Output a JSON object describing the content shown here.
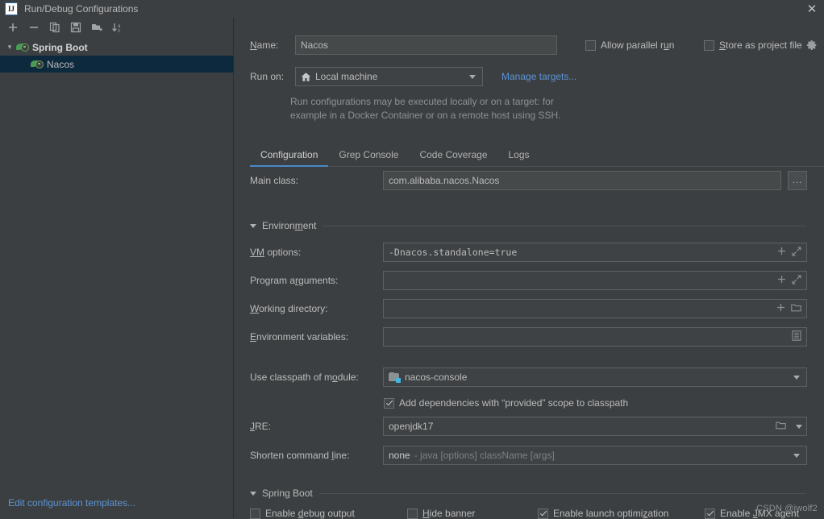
{
  "window": {
    "title": "Run/Debug Configurations",
    "app_icon": "IJ",
    "close_icon": "close-icon"
  },
  "sidebar": {
    "toolbar": [
      {
        "name": "add-configuration",
        "icon": "plus-icon"
      },
      {
        "name": "remove-configuration",
        "icon": "minus-icon"
      },
      {
        "name": "copy-configuration",
        "icon": "copy-icon"
      },
      {
        "name": "save-configuration",
        "icon": "save-icon"
      },
      {
        "name": "new-folder",
        "icon": "new-folder-icon"
      },
      {
        "name": "sort-configurations",
        "icon": "sort-alphabetical-icon"
      }
    ],
    "tree": {
      "group_label": "Spring Boot",
      "child_label": "Nacos"
    },
    "edit_templates_link": "Edit configuration templates..."
  },
  "form": {
    "name_label": "Name:",
    "name_value": "Nacos",
    "allow_parallel_run": {
      "label": "Allow parallel run",
      "checked": false
    },
    "store_as_project_file": {
      "label": "Store as project file",
      "checked": false
    },
    "run_on_label": "Run on:",
    "run_on_value": "Local machine",
    "manage_targets_link": "Manage targets...",
    "hint_line1": "Run configurations may be executed locally or on a target: for",
    "hint_line2": "example in a Docker Container or on a remote host using SSH.",
    "tabs": [
      {
        "label": "Configuration",
        "active": true
      },
      {
        "label": "Grep Console",
        "active": false
      },
      {
        "label": "Code Coverage",
        "active": false
      },
      {
        "label": "Logs",
        "active": false
      }
    ],
    "main_class": {
      "label": "Main class:",
      "value": "com.alibaba.nacos.Nacos",
      "browse_button": "..."
    },
    "environment_section": "Environment",
    "vm_options": {
      "label": "VM options:",
      "value": "-Dnacos.standalone=true"
    },
    "program_arguments": {
      "label": "Program arguments:",
      "value": ""
    },
    "working_directory": {
      "label": "Working directory:",
      "value": ""
    },
    "environment_variables": {
      "label": "Environment variables:",
      "value": ""
    },
    "use_classpath_of_module": {
      "label": "Use classpath of module:",
      "value": "nacos-console"
    },
    "add_provided_dependencies": {
      "label": "Add dependencies with “provided” scope to classpath",
      "checked": true
    },
    "jre": {
      "label": "JRE:",
      "value": "openjdk17"
    },
    "shorten_command_line": {
      "label": "Shorten command line:",
      "value": "none",
      "value_hint": "- java [options] className [args]"
    },
    "spring_boot_section": "Spring Boot",
    "spring_boot_options": [
      {
        "label": "Enable debug output",
        "checked": false
      },
      {
        "label": "Hide banner",
        "checked": false
      },
      {
        "label": "Enable launch optimization",
        "checked": true
      },
      {
        "label": "Enable JMX agent",
        "checked": true
      }
    ]
  },
  "watermark": "CSDN @jwolf2"
}
